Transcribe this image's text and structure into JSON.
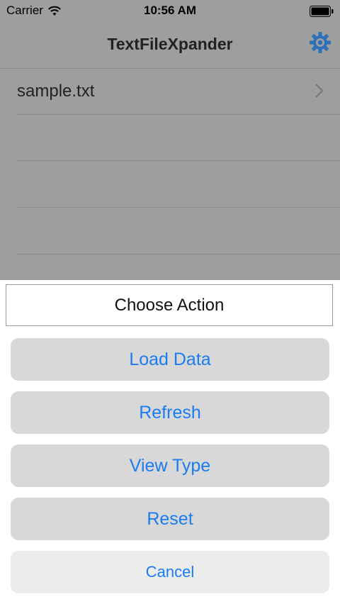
{
  "status_bar": {
    "carrier": "Carrier",
    "time": "10:56 AM"
  },
  "nav": {
    "title": "TextFileXpander",
    "settings_icon": "gear-icon"
  },
  "list": {
    "items": [
      {
        "label": "sample.txt"
      }
    ]
  },
  "action_sheet": {
    "title": "Choose Action",
    "buttons": [
      {
        "label": "Load Data"
      },
      {
        "label": "Refresh"
      },
      {
        "label": "View Type"
      },
      {
        "label": "Reset"
      }
    ],
    "cancel_label": "Cancel"
  },
  "colors": {
    "accent": "#1a7cf2",
    "dim_overlay": "#9e9e9e",
    "button_bg": "#d8d8d8",
    "cancel_bg": "#ececec"
  }
}
